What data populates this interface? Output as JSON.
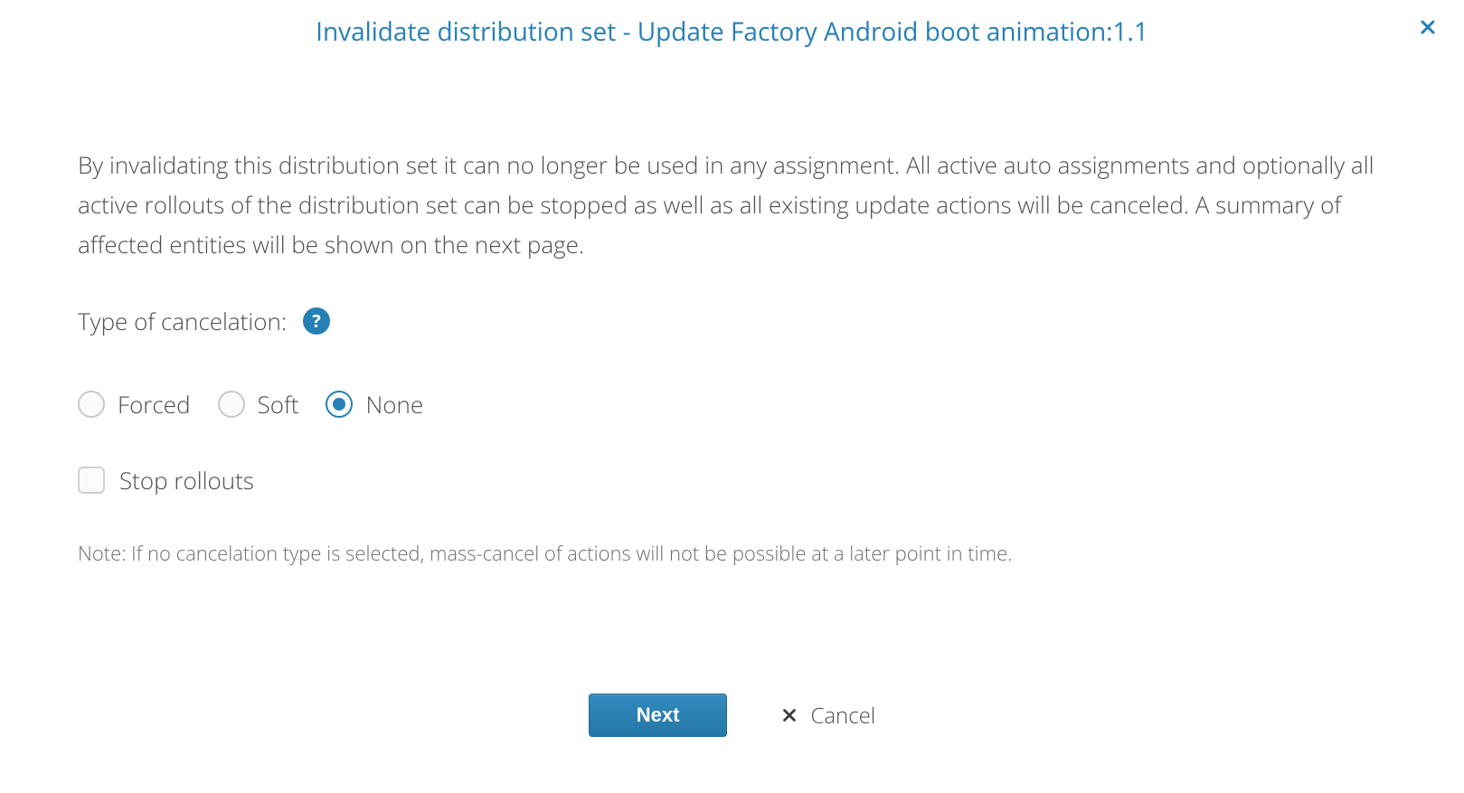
{
  "dialog": {
    "title": "Invalidate distribution set - Update Factory Android boot animation:1.1",
    "close_icon": "close-icon"
  },
  "content": {
    "description": "By invalidating this distribution set it can no longer be used in any assignment. All active auto assignments and optionally all active rollouts of the distribution set can be stopped as well as all existing update actions will be canceled. A summary of affected entities will be shown on the next page.",
    "cancelation_label": "Type of cancelation:",
    "help_icon": "question-icon",
    "radio_options": [
      {
        "label": "Forced",
        "selected": false
      },
      {
        "label": "Soft",
        "selected": false
      },
      {
        "label": "None",
        "selected": true
      }
    ],
    "checkbox": {
      "label": "Stop rollouts",
      "checked": false
    },
    "note": "Note: If no cancelation type is selected, mass-cancel of actions will not be possible at a later point in time."
  },
  "footer": {
    "next_label": "Next",
    "cancel_label": "Cancel",
    "cancel_icon": "x-icon"
  }
}
